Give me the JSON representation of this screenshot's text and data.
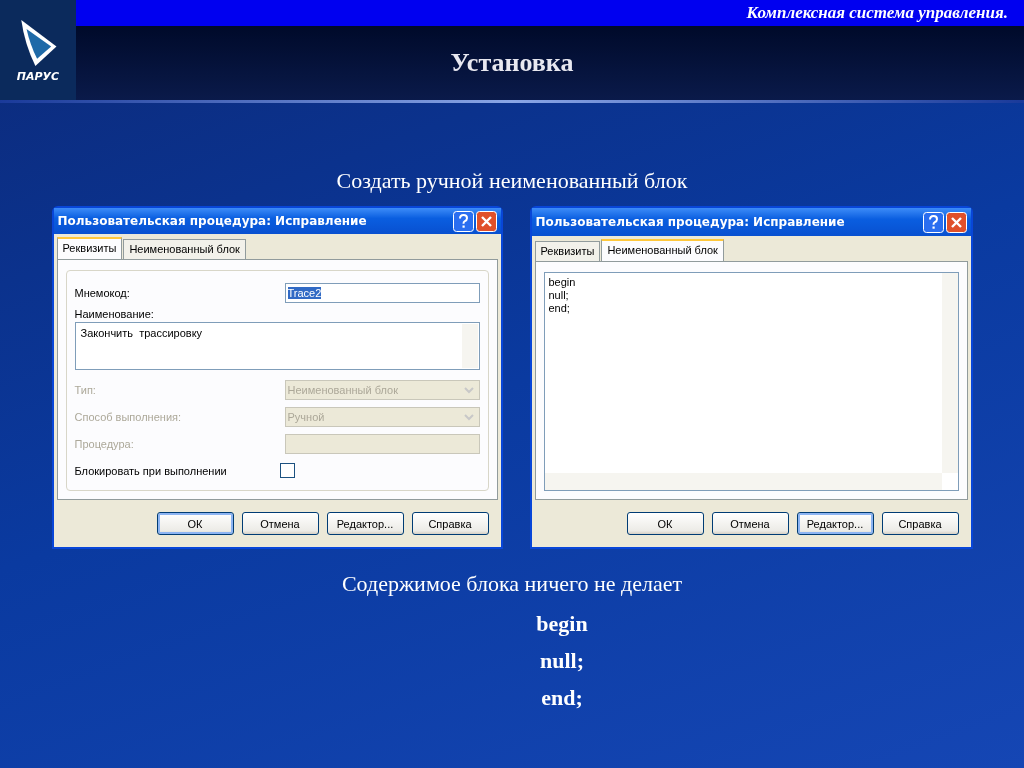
{
  "header": {
    "logo_text": "ПАРУС",
    "tagline": "Комплексная система управления.",
    "title": "Установка"
  },
  "caption": "Создать ручной неименованный блок",
  "dialogs": [
    {
      "kind": "form",
      "title": "Пользовательская процедура: Исправление",
      "tabs": [
        {
          "label": "Реквизиты",
          "selected": true
        },
        {
          "label": "Неименованный блок",
          "selected": false
        }
      ],
      "fields": [
        {
          "kind": "text",
          "label": "Мнемокод:",
          "value": "Trace2",
          "disabled": false
        },
        {
          "kind": "memo",
          "label": "Наименование:",
          "value": "Закончить  трассировку",
          "disabled": false
        },
        {
          "kind": "combo",
          "label": "Тип:",
          "value": "Неименованный блок",
          "disabled": true
        },
        {
          "kind": "combo",
          "label": "Способ выполнения:",
          "value": "Ручной",
          "disabled": true
        },
        {
          "kind": "text",
          "label": "Процедура:",
          "disabled": true
        },
        {
          "kind": "checkbox",
          "label": "Блокировать при выполнении",
          "checked": false,
          "disabled": false
        }
      ],
      "buttons": [
        {
          "label": "ОК",
          "default": true
        },
        {
          "label": "Отмена",
          "default": false
        },
        {
          "label": "Редактор...",
          "default": false
        },
        {
          "label": "Справка",
          "default": false
        }
      ]
    },
    {
      "kind": "code",
      "title": "Пользовательская процедура: Исправление",
      "tabs": [
        {
          "label": "Реквизиты",
          "selected": false
        },
        {
          "label": "Неименованный блок",
          "selected": true
        }
      ],
      "code_lines": [
        "begin",
        "null;",
        "end;"
      ],
      "buttons": [
        {
          "label": "ОК",
          "default": false
        },
        {
          "label": "Отмена",
          "default": false
        },
        {
          "label": "Редактор...",
          "default": true
        },
        {
          "label": "Справка",
          "default": false
        }
      ]
    }
  ],
  "footer": {
    "description": "Содержимое блока ничего не делает",
    "code_lines": [
      "begin",
      "null;",
      "end;"
    ]
  }
}
